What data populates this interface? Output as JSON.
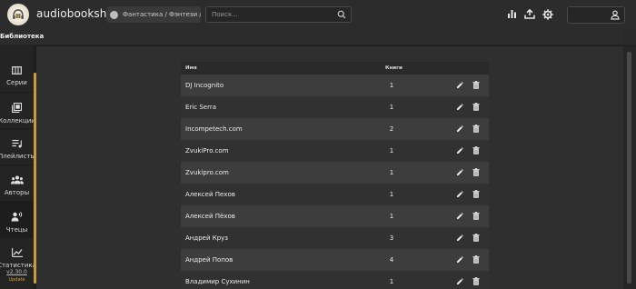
{
  "app": {
    "title": "audiobookshelf",
    "library_selector": "Фантастика / Фэнтези / ...",
    "search_placeholder": "Поиск..."
  },
  "library_label": "Библиотека",
  "sidebar": {
    "items": [
      {
        "label": "Серии",
        "icon": "columns-icon",
        "active": false
      },
      {
        "label": "Коллекции",
        "icon": "collections-icon",
        "active": false
      },
      {
        "label": "Плейлисты",
        "icon": "playlist-icon",
        "active": false
      },
      {
        "label": "Авторы",
        "icon": "authors-icon",
        "active": false
      },
      {
        "label": "Чтецы",
        "icon": "narrator-icon",
        "active": true
      },
      {
        "label": "Статистика",
        "icon": "stats-icon",
        "active": false
      }
    ],
    "version": "v2.30.0",
    "update": "Update"
  },
  "table": {
    "headers": {
      "name": "Имя",
      "books": "Книги"
    },
    "rows": [
      {
        "name": "DJ Incognito",
        "books": "1"
      },
      {
        "name": "Eric Serra",
        "books": "1"
      },
      {
        "name": "Incompetech.com",
        "books": "2"
      },
      {
        "name": "ZvukiPro.com",
        "books": "1"
      },
      {
        "name": "Zvukipro.com",
        "books": "1"
      },
      {
        "name": "Алексей Пехов",
        "books": "1"
      },
      {
        "name": "Алексей Пёхов",
        "books": "1"
      },
      {
        "name": "Андрей Круз",
        "books": "3"
      },
      {
        "name": "Андрей Попов",
        "books": "4"
      },
      {
        "name": "Владимир Сухинин",
        "books": "1"
      }
    ]
  },
  "colors": {
    "accent": "#c79a3a",
    "appbar": "#2c2c2c",
    "background": "#2f2f2f"
  }
}
